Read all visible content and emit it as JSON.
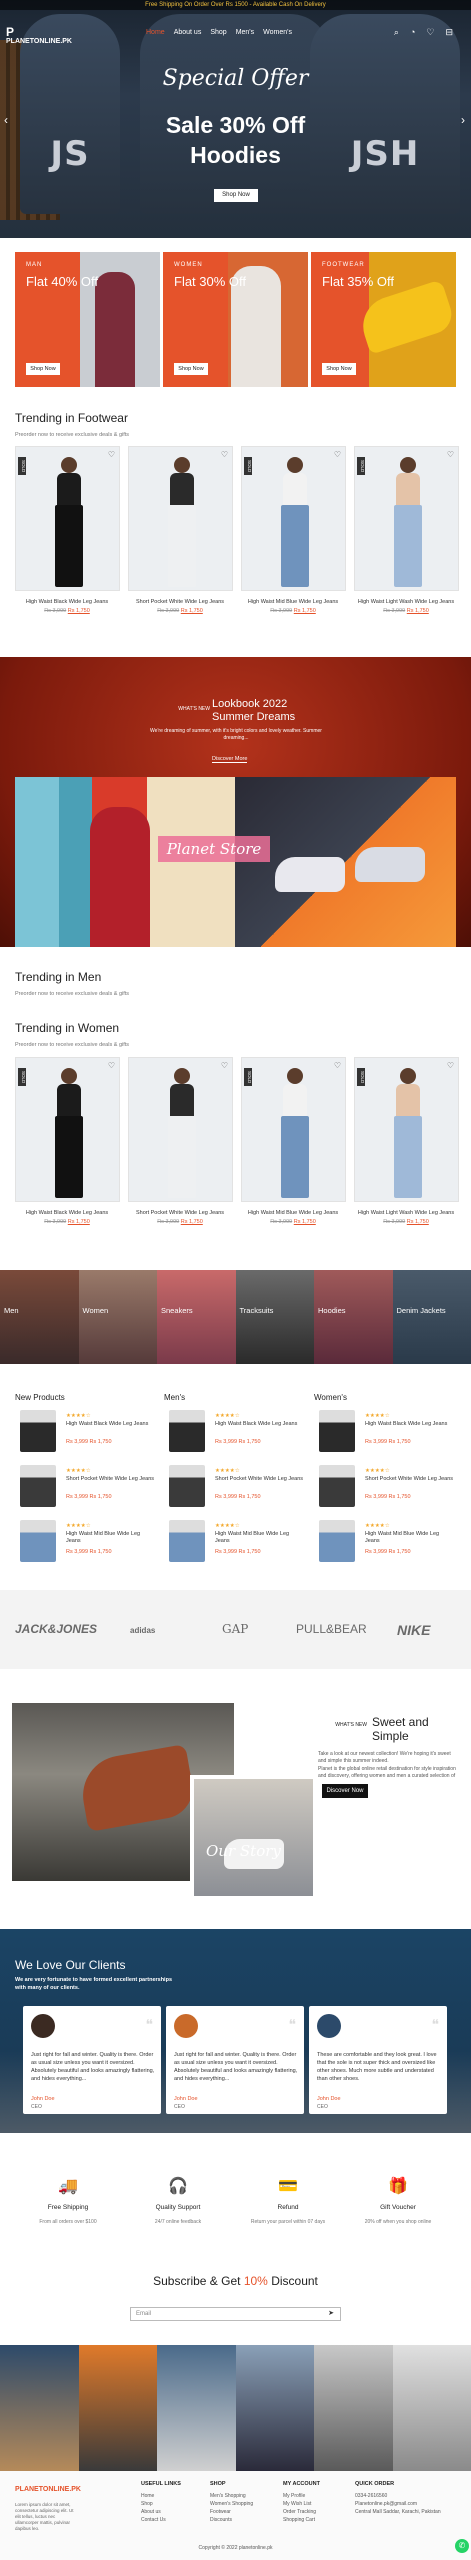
{
  "topbar": {
    "text": "Free Shipping On Order Over Rs 1500 - Available Cash On Delivery"
  },
  "logo": {
    "mark": "P",
    "name": "PLANETONLINE.PK"
  },
  "nav": {
    "items": [
      "Home",
      "About us",
      "Shop",
      "Men's",
      "Women's"
    ]
  },
  "hero": {
    "script": "Special Offer",
    "title_1": "Sale 30% Off",
    "title_2": "Hoodies",
    "button": "Shop Now",
    "prev": "‹",
    "next": "›"
  },
  "tiles": [
    {
      "tag": "MAN",
      "flat": "Flat 40% Off",
      "button": "Shop Now",
      "bg": "#e5532b"
    },
    {
      "tag": "WOMEN",
      "flat": "Flat 30% Off",
      "button": "Shop Now",
      "bg": "#e5532b"
    },
    {
      "tag": "FOOTWEAR",
      "flat": "Flat 35% Off",
      "button": "Shop Now",
      "bg": "#e5532b"
    }
  ],
  "footwear": {
    "title": "Trending in Footwear",
    "subtitle": "Preorder now to receive exclusive deals & gifts"
  },
  "products": [
    {
      "name": "High Waist Black Wide Leg Jeans",
      "old": "Rs 3,999",
      "new": "Rs 1,750",
      "sold": "SOLD",
      "top": "#1b1b1b",
      "legs": "#111"
    },
    {
      "name": "Short Pocket White Wide Leg Jeans",
      "old": "Rs 3,999",
      "new": "Rs 1,750",
      "sold": "",
      "top": "#2a2a2a",
      "legs": "#eef0f2"
    },
    {
      "name": "High Waist Mid Blue Wide Leg Jeans",
      "old": "Rs 3,999",
      "new": "Rs 1,750",
      "sold": "SOLD",
      "top": "#f2f2f2",
      "legs": "#6f93bd"
    },
    {
      "name": "High Waist Light Wash Wide Leg Jeans",
      "old": "Rs 3,999",
      "new": "Rs 1,750",
      "sold": "SOLD",
      "top": "#e4c3a8",
      "legs": "#9fb9d8"
    }
  ],
  "lookbook": {
    "what": "WHAT'S NEW",
    "title_1": "Lookbook 2022",
    "title_2": "Summer Dreams",
    "desc": "We're dreaming of summer, with it's bright colors and lovely weather. Summer dreaming...",
    "button": "Discover More",
    "overlay": "Planet Store"
  },
  "men": {
    "title": "Trending in Men",
    "subtitle": "Preorder now to receive exclusive deals & gifts"
  },
  "women": {
    "title": "Trending in Women",
    "subtitle": "Preorder now to receive exclusive deals & gifts"
  },
  "categories": [
    "Men",
    "Women",
    "Sneakers",
    "Tracksuits",
    "Hoodies",
    "Denim Jackets"
  ],
  "lists": {
    "titles": [
      "New Products",
      "Men's",
      "Women's"
    ],
    "stars": "★★★★☆",
    "items": [
      {
        "name": "High Waist Black Wide Leg Jeans",
        "price": "Rs 3,999 Rs 1,750"
      },
      {
        "name": "Short Pocket White Wide Leg Jeans",
        "price": "Rs 3,999 Rs 1,750"
      },
      {
        "name": "High Waist Mid Blue Wide Leg Jeans",
        "price": "Rs 3,999 Rs 1,750"
      }
    ]
  },
  "brands": [
    "JACK&JONES",
    "adidas",
    "GAP",
    "PULL&BEAR",
    "NIKE"
  ],
  "about": {
    "what": "WHAT'S NEW",
    "title_1": "Sweet and",
    "title_2": "Simple",
    "p1": "Take a look at our newest collection! We're hoping it's sweet and simple this summer indeed.",
    "p2": "Planet is the global online retail destination for style inspiration and discovery, offering women and men a curated selection of ready-to-wear & accessories from over 1,500 established and emerging designers.",
    "button": "Discover Now",
    "overlay": "Our Story"
  },
  "clients": {
    "title": "We Love Our Clients",
    "subtitle": "We are very fortunate to have formed excellent partnerships with many of our clients.",
    "reviews": [
      {
        "text": "Just right for fall and winter. Quality is there. Order as usual size unless you want it oversized. Absolutely beautiful and looks amazingly flattering, and hides everything...",
        "name": "John Doe",
        "role": "CEO",
        "color": "#3b2a22"
      },
      {
        "text": "Just right for fall and winter. Quality is there. Order as usual size unless you want it oversized. Absolutely beautiful and looks amazingly flattering, and hides everything...",
        "name": "John Doe",
        "role": "CEO",
        "color": "#c96a2a"
      },
      {
        "text": "These are comfortable and they look great. I love that the sole is not super thick and oversized like other shoes. Much more subtle and understated than other shoes.",
        "name": "John Doe",
        "role": "CEO",
        "color": "#2c4a6a"
      }
    ],
    "quote": "❝"
  },
  "features": [
    {
      "icon": "🚚",
      "title": "Free Shipping",
      "desc": "From all orders over $100"
    },
    {
      "icon": "🎧",
      "title": "Quality Support",
      "desc": "24/7 online feedback"
    },
    {
      "icon": "💳",
      "title": "Refund",
      "desc": "Return your parcel within 07 days"
    },
    {
      "icon": "🎁",
      "title": "Gift Voucher",
      "desc": "20% off when you shop online"
    }
  ],
  "subscribe": {
    "title_pre": "Subscribe & Get ",
    "pct": "10%",
    "title_post": " Discount",
    "placeholder": "Email",
    "arrow": "➤"
  },
  "footer": {
    "logo": "PLANETONLINE.PK",
    "desc": "Lorem ipsum dolor sit amet, consectetur adipiscing elit. Ut elit tellus, luctus nec ullamcorper mattis, pulvinar dapibus leo.",
    "cols": [
      {
        "head": "USEFUL LINKS",
        "links": [
          "Home",
          "Shop",
          "About us",
          "Contact Us"
        ]
      },
      {
        "head": "SHOP",
        "links": [
          "Men's Shopping",
          "Women's Shopping",
          "Footwear",
          "Discounts"
        ]
      },
      {
        "head": "MY ACCOUNT",
        "links": [
          "My Profile",
          "My Wish List",
          "Order Tracking",
          "Shopping Cart"
        ]
      },
      {
        "head": "QUICK ORDER",
        "links": [
          "0334-2616560",
          "Planetonline.pk@gmail.com",
          "Central Mall Saddar, Karachi, Pakistan"
        ]
      }
    ],
    "copyright": "Copyright © 2022 planetonline.pk"
  }
}
